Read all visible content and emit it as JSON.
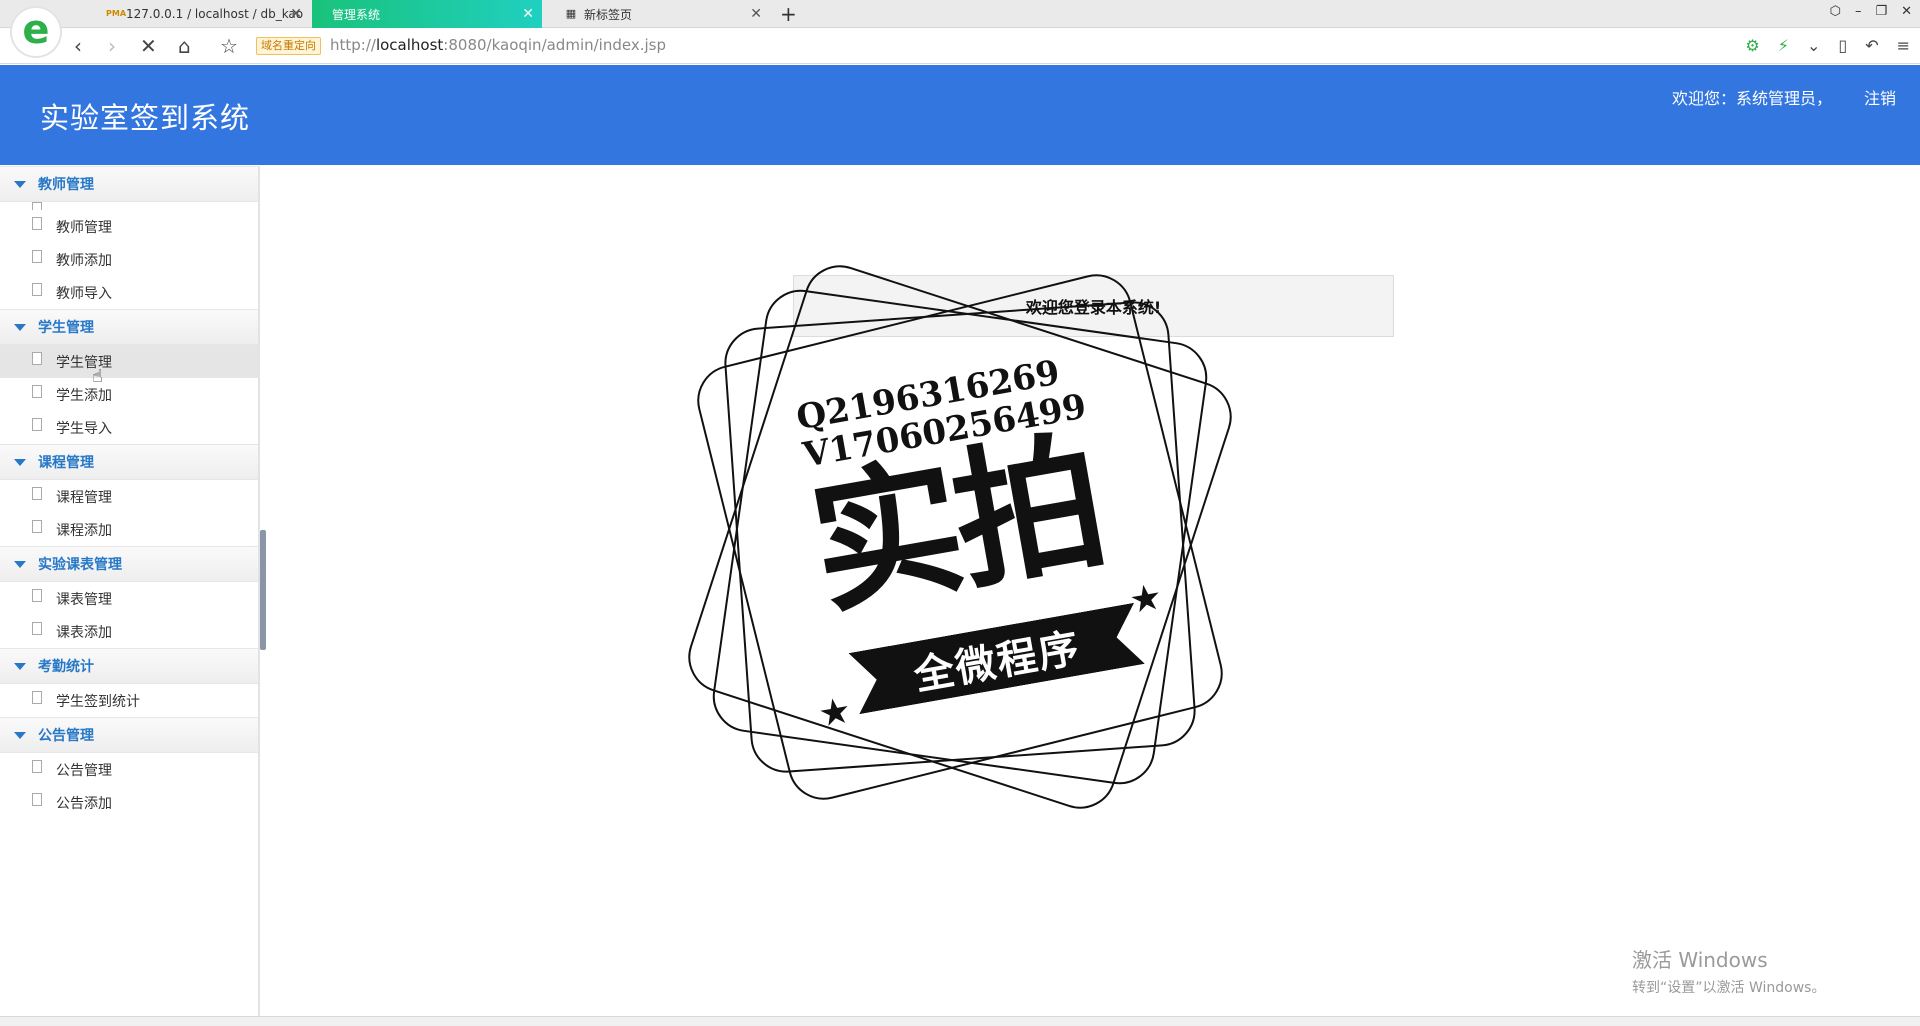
{
  "browser": {
    "tabs": [
      {
        "label": "127.0.0.1 / localhost / db_kao",
        "icon": "PMA"
      },
      {
        "label": "管理系统"
      },
      {
        "label": "新标签页"
      }
    ],
    "redirect_badge": "域名重定向",
    "url_prefix": "http://",
    "url_host": "localhost",
    "url_rest": ":8080/kaoqin/admin/index.jsp"
  },
  "header": {
    "title": "实验室签到系统",
    "welcome": "欢迎您：系统管理员，",
    "logout": "注销"
  },
  "sidebar": {
    "groups": [
      {
        "title": "教师管理",
        "items": [
          "教师管理",
          "教师添加",
          "教师导入"
        ]
      },
      {
        "title": "学生管理",
        "items": [
          "学生管理",
          "学生添加",
          "学生导入"
        ]
      },
      {
        "title": "课程管理",
        "items": [
          "课程管理",
          "课程添加"
        ]
      },
      {
        "title": "实验课表管理",
        "items": [
          "课表管理",
          "课表添加"
        ]
      },
      {
        "title": "考勤统计",
        "items": [
          "学生签到统计"
        ]
      },
      {
        "title": "公告管理",
        "items": [
          "公告管理",
          "公告添加"
        ]
      }
    ]
  },
  "main": {
    "welcome_message": "欢迎您登录本系统!"
  },
  "watermark_stamp": {
    "line1": "Q2196316269",
    "line2": "V17060256499",
    "main": "实拍",
    "banner": "全微程序"
  },
  "windows_watermark": {
    "line1": "激活 Windows",
    "line2": "转到“设置”以激活 Windows。"
  }
}
